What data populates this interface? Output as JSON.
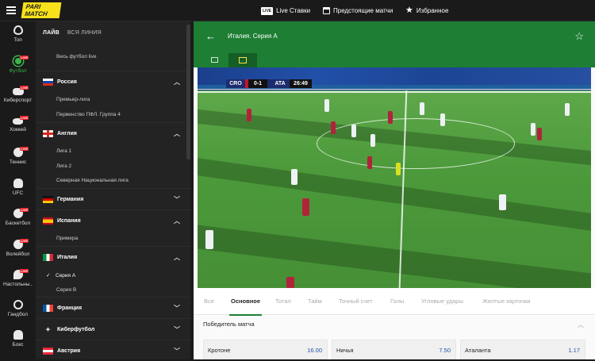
{
  "topbar": {
    "logo_line1": "PARI",
    "logo_line2": "MATCH",
    "live_badge": "LIVE",
    "nav": [
      "Live Ставки",
      "Предстоящие матчи",
      "Избранное"
    ]
  },
  "sports": [
    {
      "label": "Топ",
      "live": false,
      "active": false
    },
    {
      "label": "Футбол",
      "live": true,
      "active": true
    },
    {
      "label": "Киберспорт",
      "live": true,
      "active": false
    },
    {
      "label": "Хоккей",
      "live": true,
      "active": false
    },
    {
      "label": "Теннис",
      "live": true,
      "active": false
    },
    {
      "label": "UFC",
      "live": false,
      "active": false
    },
    {
      "label": "Баскетбол",
      "live": true,
      "active": false
    },
    {
      "label": "Волейбол",
      "live": true,
      "active": false
    },
    {
      "label": "Настольны..",
      "live": true,
      "active": false
    },
    {
      "label": "Гандбол",
      "live": false,
      "active": false
    },
    {
      "label": "Бокс",
      "live": false,
      "active": false
    }
  ],
  "live_badge_small": "LIVE",
  "leagues": {
    "tab_live": "ЛАЙВ",
    "tab_all": "ВСЯ ЛИНИЯ",
    "all_football": "Весь футбол live",
    "countries": [
      {
        "name": "Россия",
        "expanded": true,
        "items": [
          "Премьер-лига",
          "Первенство ПФЛ. Группа 4"
        ]
      },
      {
        "name": "Англия",
        "expanded": true,
        "items": [
          "Лига 1",
          "Лига 2",
          "Северная Национальная лига"
        ]
      },
      {
        "name": "Германия",
        "expanded": false,
        "items": []
      },
      {
        "name": "Испания",
        "expanded": true,
        "items": [
          "Примера"
        ]
      },
      {
        "name": "Италия",
        "expanded": true,
        "items": [
          "Серия А",
          "Серия В"
        ]
      },
      {
        "name": "Франция",
        "expanded": false,
        "items": []
      },
      {
        "name": "Киберфутбол",
        "expanded": false,
        "items": []
      },
      {
        "name": "Австрия",
        "expanded": false,
        "items": []
      }
    ],
    "selected_league": "Серия А"
  },
  "match": {
    "title": "Италия. Серия А",
    "scoreboard": {
      "home": "CRO",
      "score": "0-1",
      "away": "ATA",
      "time": "26:49"
    }
  },
  "bet_tabs": [
    "Все",
    "Основное",
    "Тотал",
    "Тайм",
    "Точный счет",
    "Голы",
    "Угловые удары",
    "Желтые карточки"
  ],
  "active_bet_tab": "Основное",
  "market": {
    "title": "Победитель матча",
    "outcomes": [
      {
        "name": "Кротоне",
        "odds": "16.00"
      },
      {
        "name": "Ничья",
        "odds": "7.50"
      },
      {
        "name": "Аталанта",
        "odds": "1.17"
      }
    ]
  },
  "colors": {
    "accent_green": "#1e7e34",
    "live_red": "#e8212b",
    "brand_yellow": "#f7e11a",
    "odds_blue": "#1f4fa8"
  },
  "icons": [
    "menu-icon",
    "live-tv-icon",
    "calendar-icon",
    "star-icon",
    "back-arrow-icon",
    "favorite-star-icon",
    "scoreboard-icon",
    "video-icon",
    "chevron-up-icon",
    "chevron-down-icon",
    "checkmark-icon"
  ]
}
